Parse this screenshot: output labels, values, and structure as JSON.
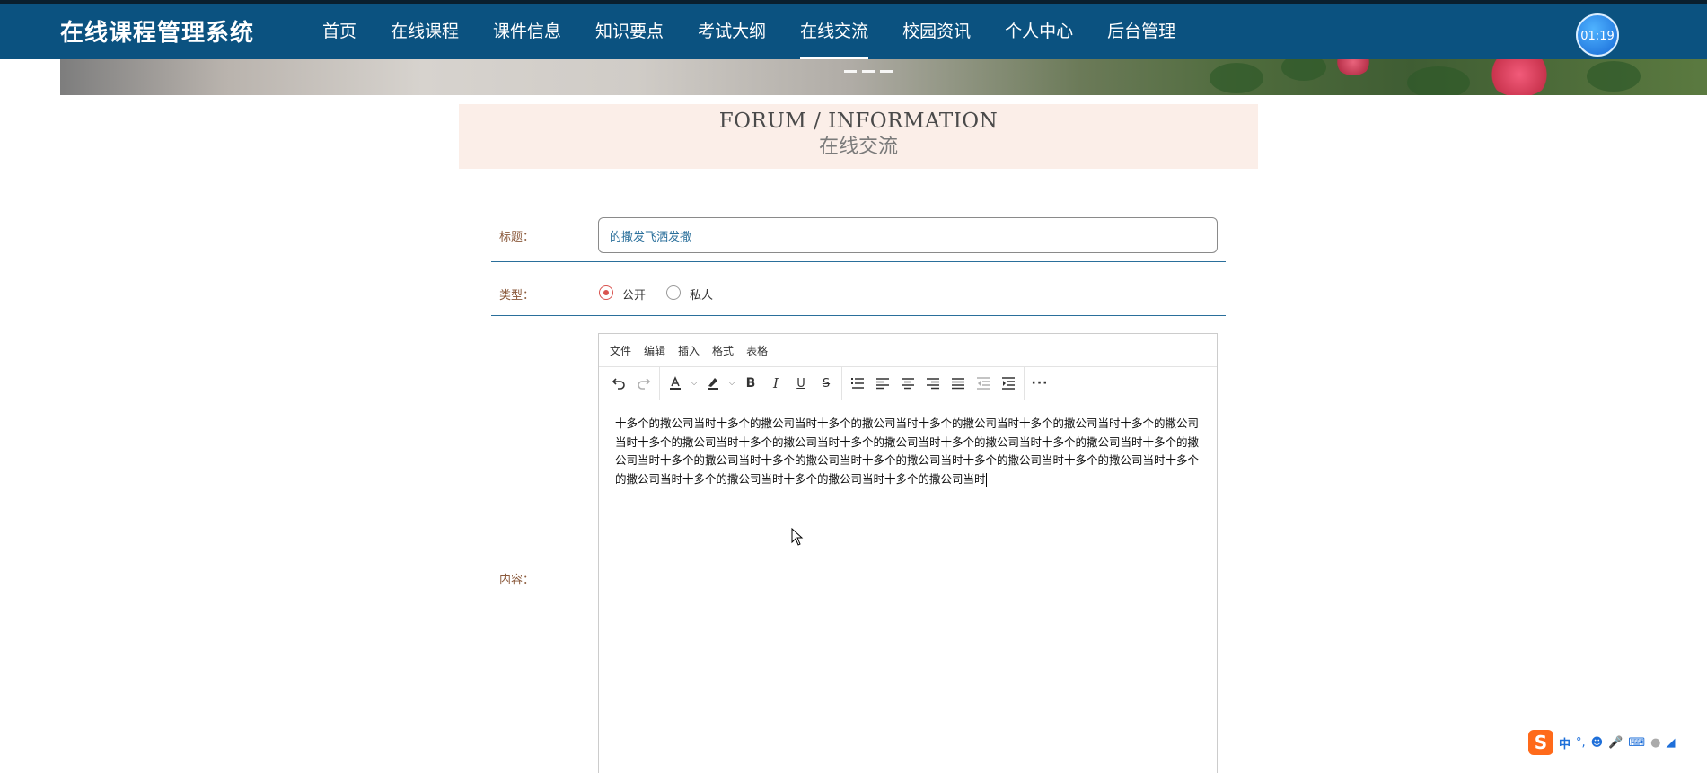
{
  "header": {
    "site_title": "在线课程管理系统",
    "nav": [
      "首页",
      "在线课程",
      "课件信息",
      "知识要点",
      "考试大纲",
      "在线交流",
      "校园资讯",
      "个人中心",
      "后台管理"
    ],
    "active_nav": "在线交流",
    "timer": "01:19"
  },
  "section": {
    "title_en": "FORUM / INFORMATION",
    "title_cn": "在线交流"
  },
  "form": {
    "title_label": "标题：",
    "title_value": "的撒发飞洒发撒",
    "type_label": "类型：",
    "type_options": [
      "公开",
      "私人"
    ],
    "type_selected": "公开",
    "content_label": "内容："
  },
  "editor": {
    "menu": [
      "文件",
      "编辑",
      "插入",
      "格式",
      "表格"
    ],
    "toolbar_icons": [
      "undo-icon",
      "redo-icon",
      "font-color-icon",
      "highlight-icon",
      "bold-icon",
      "italic-icon",
      "underline-icon",
      "strikethrough-icon",
      "list-icon",
      "align-left-icon",
      "align-center-icon",
      "align-right-icon",
      "align-justify-icon",
      "outdent-icon",
      "indent-icon",
      "more-icon"
    ],
    "content": "十多个的撒公司当时十多个的撒公司当时十多个的撒公司当时十多个的撒公司当时十多个的撒公司当时十多个的撒公司当时十多个的撒公司当时十多个的撒公司当时十多个的撒公司当时十多个的撒公司当时十多个的撒公司当时十多个的撒公司当时十多个的撒公司当时十多个的撒公司当时十多个的撒公司当时十多个的撒公司当时十多个的撒公司当时十多个的撒公司当时十多个的撒公司当时十多个的撒公司当时十多个的撒公司当时"
  },
  "ime": {
    "mode": "中",
    "punct": "°,"
  },
  "colors": {
    "nav_bg": "#0b5280",
    "section_bg": "#fbeee8",
    "label": "#8b5a3c",
    "accent_line": "#2a6f9b",
    "radio_checked": "#d9534f"
  }
}
